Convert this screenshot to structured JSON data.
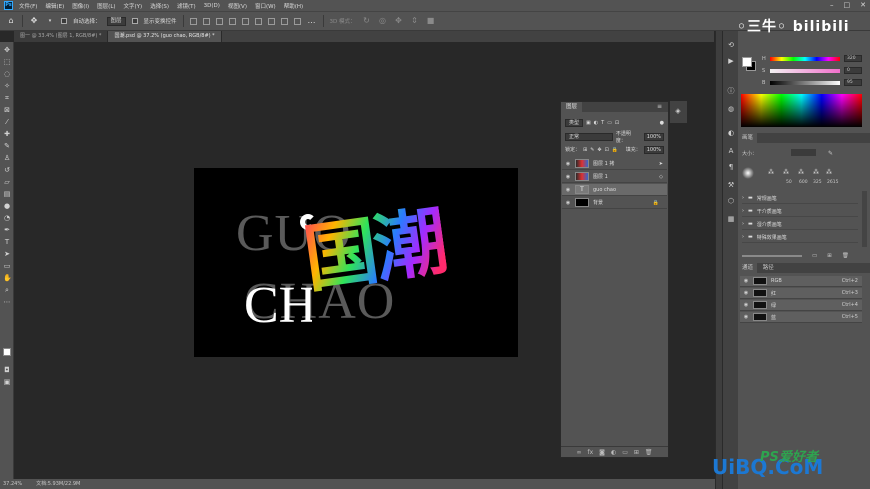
{
  "menu": {
    "logo": "Ps",
    "items": [
      "文件(F)",
      "编辑(E)",
      "图像(I)",
      "图层(L)",
      "文字(Y)",
      "选择(S)",
      "滤镜(T)",
      "3D(D)",
      "视图(V)",
      "窗口(W)",
      "帮助(H)"
    ],
    "window_controls": [
      "–",
      "□",
      "✕"
    ]
  },
  "options": {
    "auto_select_label": "自动选择：",
    "auto_select_value": "图层",
    "show_transform_label": "显示变换控件",
    "mode_3d_label": "3D 模式："
  },
  "tabs": [
    {
      "label": "图一 @ 33.4% (图层 1, RGB/8#) *"
    },
    {
      "label": "国潮.psd @ 37.2% (guo  chao, RGB/8#) *"
    }
  ],
  "canvas": {
    "line1": "GUO",
    "line2": "CHAO",
    "calligraphy": "国潮"
  },
  "status": {
    "zoom": "37.24%",
    "doc": "文档:5.93M/22.9M"
  },
  "layers_panel": {
    "tab": "图层",
    "filter_label": "类型",
    "blend_mode": "正常",
    "opacity_label": "不透明度：",
    "opacity_value": "100%",
    "lock_label": "锁定：",
    "fill_label": "填充：",
    "fill_value": "100%",
    "layers": [
      {
        "name": "图层 1 拷",
        "selected": false
      },
      {
        "name": "图层 1",
        "selected": false
      },
      {
        "name": "guo  chao",
        "selected": true
      },
      {
        "name": "背景",
        "selected": false
      }
    ],
    "footer_icons": [
      "∞",
      "fx",
      "◙",
      "◐",
      "▭",
      "⊞",
      "🗑"
    ]
  },
  "color_panel": {
    "h_label": "H",
    "s_label": "S",
    "b_label": "B",
    "h_value": "320",
    "s_value": "0",
    "b_value": "95"
  },
  "brushes_panel": {
    "tab": "画笔",
    "size_label": "大小：",
    "brush_sizes": [
      "50",
      "600",
      "325",
      "2615"
    ],
    "folders": [
      "常规画笔",
      "干介质画笔",
      "湿介质画笔",
      "特殊效果画笔"
    ]
  },
  "channels_panel": {
    "tabs": [
      "通道",
      "路径"
    ],
    "channels": [
      {
        "name": "RGB",
        "shortcut": "Ctrl+2"
      },
      {
        "name": "红",
        "shortcut": "Ctrl+3"
      },
      {
        "name": "绿",
        "shortcut": "Ctrl+4"
      },
      {
        "name": "蓝",
        "shortcut": "Ctrl+5"
      }
    ]
  },
  "watermarks": {
    "bilibili": "◦三牛◦ bilibili",
    "uibo": "UiBQ.CoM",
    "ps": "PS爱好者"
  }
}
